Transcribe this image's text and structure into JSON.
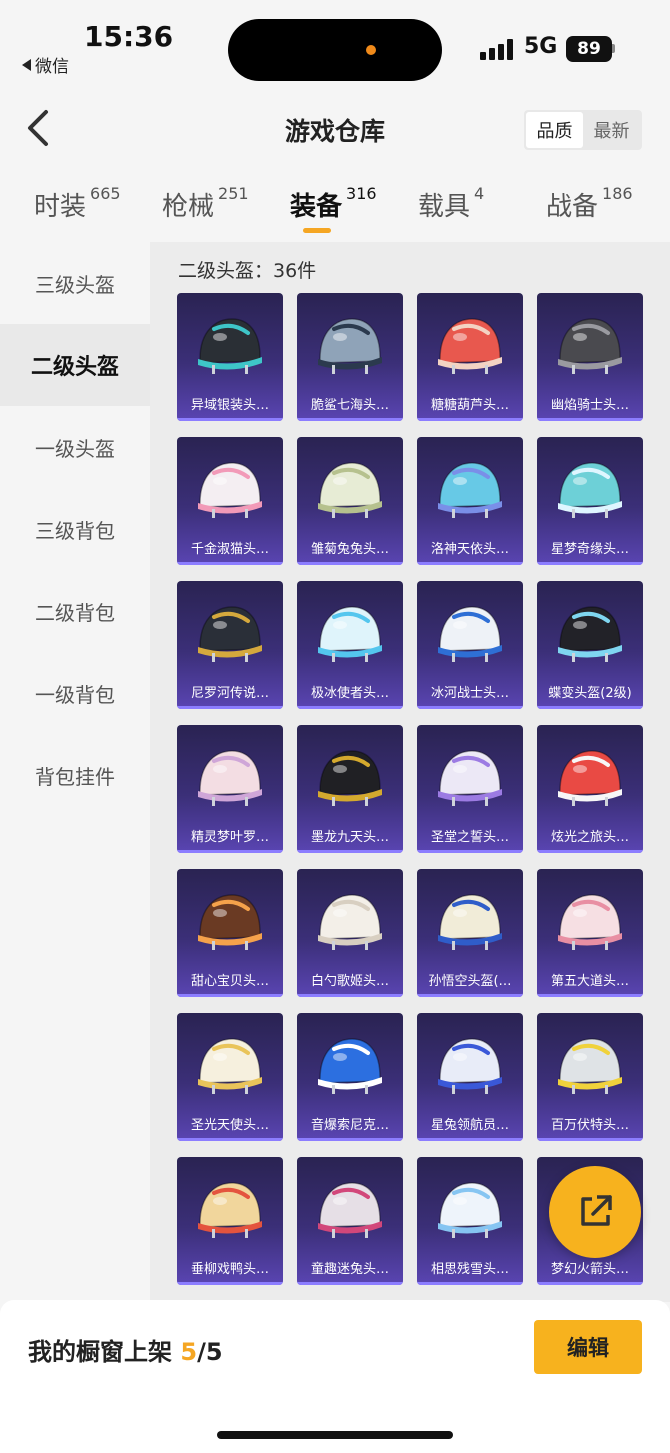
{
  "status_bar": {
    "time": "15:36",
    "back_app": "微信",
    "network": "5G",
    "battery": "89"
  },
  "header": {
    "title": "游戏仓库",
    "sort_options": [
      "品质",
      "最新"
    ]
  },
  "tabs": [
    {
      "label": "时装",
      "count": "665"
    },
    {
      "label": "枪械",
      "count": "251"
    },
    {
      "label": "装备",
      "count": "316"
    },
    {
      "label": "载具",
      "count": "4"
    },
    {
      "label": "战备",
      "count": "186"
    }
  ],
  "sidebar": [
    "三级头盔",
    "二级头盔",
    "一级头盔",
    "三级背包",
    "二级背包",
    "一级背包",
    "背包挂件"
  ],
  "section_title": "二级头盔：36件",
  "items": [
    {
      "name": "异域银装头…",
      "color": "#2a2f35",
      "trim": "#3ec5c8"
    },
    {
      "name": "脆鲨七海头…",
      "color": "#8fa3b8",
      "trim": "#2b3a4e"
    },
    {
      "name": "糖糖葫芦头…",
      "color": "#e8584e",
      "trim": "#f3d3c3"
    },
    {
      "name": "幽焰骑士头…",
      "color": "#4a4a4f",
      "trim": "#9a9aa0"
    },
    {
      "name": "千金淑猫头…",
      "color": "#f4eef2",
      "trim": "#f29ab8"
    },
    {
      "name": "雏菊兔兔头…",
      "color": "#e7ecd5",
      "trim": "#b6c18e"
    },
    {
      "name": "洛神天依头…",
      "color": "#67c9e6",
      "trim": "#7a8fe8"
    },
    {
      "name": "星梦奇缘头…",
      "color": "#6dd0d7",
      "trim": "#dff6ff"
    },
    {
      "name": "尼罗河传说…",
      "color": "#2a2f38",
      "trim": "#d5a93d"
    },
    {
      "name": "极冰使者头…",
      "color": "#dff4fb",
      "trim": "#54c6ee"
    },
    {
      "name": "冰河战士头…",
      "color": "#eef2f7",
      "trim": "#2e6fd5"
    },
    {
      "name": "蝶变头盔(2级)",
      "color": "#222228",
      "trim": "#7fd6f0"
    },
    {
      "name": "精灵梦叶罗…",
      "color": "#f3dde3",
      "trim": "#cfa6d8"
    },
    {
      "name": "墨龙九天头…",
      "color": "#202024",
      "trim": "#d4a92e"
    },
    {
      "name": "圣堂之誓头…",
      "color": "#ece8f6",
      "trim": "#9c7be3"
    },
    {
      "name": "炫光之旅头…",
      "color": "#e94a44",
      "trim": "#f7f7f7"
    },
    {
      "name": "甜心宝贝头…",
      "color": "#6a3a23",
      "trim": "#f5a24b"
    },
    {
      "name": "白勺歌姬头…",
      "color": "#f3efe8",
      "trim": "#d8cfc1"
    },
    {
      "name": "孙悟空头盔(…",
      "color": "#f1ecd8",
      "trim": "#2f5dc9"
    },
    {
      "name": "第五大道头…",
      "color": "#f6dfe3",
      "trim": "#e88fa3"
    },
    {
      "name": "圣光天使头…",
      "color": "#f6f0de",
      "trim": "#e9c45a"
    },
    {
      "name": "音爆索尼克…",
      "color": "#2c6fe0",
      "trim": "#ffffff"
    },
    {
      "name": "星兔领航员…",
      "color": "#e8ecf8",
      "trim": "#3a58d8"
    },
    {
      "name": "百万伏特头…",
      "color": "#dfe3e6",
      "trim": "#f0d23b"
    },
    {
      "name": "垂柳戏鸭头…",
      "color": "#f1d69c",
      "trim": "#e4543e"
    },
    {
      "name": "童趣迷兔头…",
      "color": "#e6dfe6",
      "trim": "#d2477a"
    },
    {
      "name": "相思残雪头…",
      "color": "#eef4fb",
      "trim": "#86c5f2"
    },
    {
      "name": "梦幻火箭头…",
      "color": "#8fd0ee",
      "trim": "#ffffff"
    }
  ],
  "footer": {
    "label": "我的橱窗上架",
    "current": "5",
    "total": "/5",
    "edit": "编辑"
  },
  "colors": {
    "accent": "#f7b21e",
    "card_top": "#2a2352",
    "card_bottom": "#5a45b3"
  }
}
